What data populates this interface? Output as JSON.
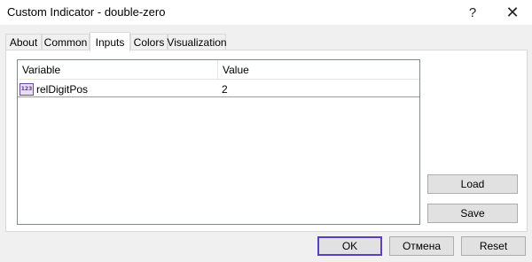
{
  "window": {
    "title": "Custom Indicator - double-zero",
    "help_glyph": "?",
    "close_glyph": "✕"
  },
  "tabs": [
    {
      "label": "About"
    },
    {
      "label": "Common"
    },
    {
      "label": "Inputs",
      "active": true
    },
    {
      "label": "Colors"
    },
    {
      "label": "Visualization"
    }
  ],
  "inputs_table": {
    "headers": {
      "variable": "Variable",
      "value": "Value"
    },
    "rows": [
      {
        "icon": "integer-type-icon",
        "icon_text": "123",
        "variable": "relDigitPos",
        "value": "2"
      }
    ]
  },
  "side_buttons": {
    "load": "Load",
    "save": "Save"
  },
  "dialog_buttons": {
    "ok": "OK",
    "cancel": "Отмена",
    "reset": "Reset"
  },
  "colors": {
    "ok_border": "#5b3fbe",
    "window_bg": "#f0f0f0",
    "panel_bg": "#ffffff"
  }
}
